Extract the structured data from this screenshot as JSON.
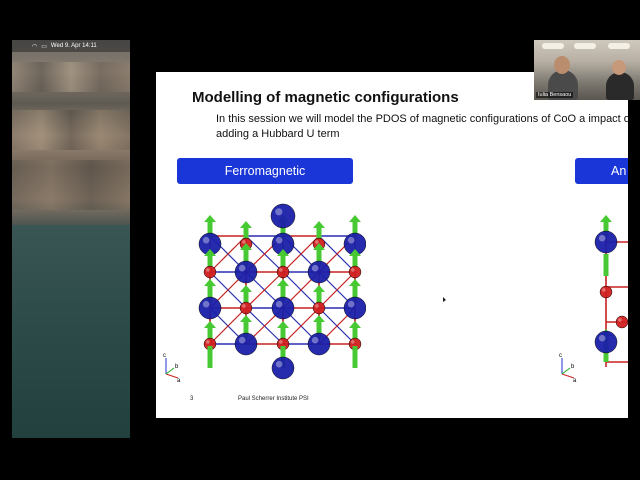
{
  "menubar": {
    "datetime": "Wed 9. Apr 14:11"
  },
  "slide": {
    "title": "Modelling of magnetic configurations",
    "text": "In this session we will model the PDOS of magnetic configurations of CoO a impact of adding a Hubbard U term",
    "tabs": [
      {
        "label": "Ferromagnetic"
      },
      {
        "label": "An"
      }
    ],
    "axes_left": {
      "c": "c",
      "b": "b",
      "a": "a"
    },
    "axes_right": {
      "c": "c",
      "b": "b",
      "a": "a"
    },
    "footer_page": "3",
    "footer_institute": "Paul Scherrer Institute PSI"
  },
  "webcam": {
    "name": "Iulia Bensaou"
  },
  "colors": {
    "tab_blue": "#1a35d8",
    "atom_blue": "#1b1fa8",
    "atom_red": "#d11f1f",
    "spin_green": "#47c933",
    "bond_red": "#c82020",
    "bond_blue": "#2a2fb0"
  }
}
